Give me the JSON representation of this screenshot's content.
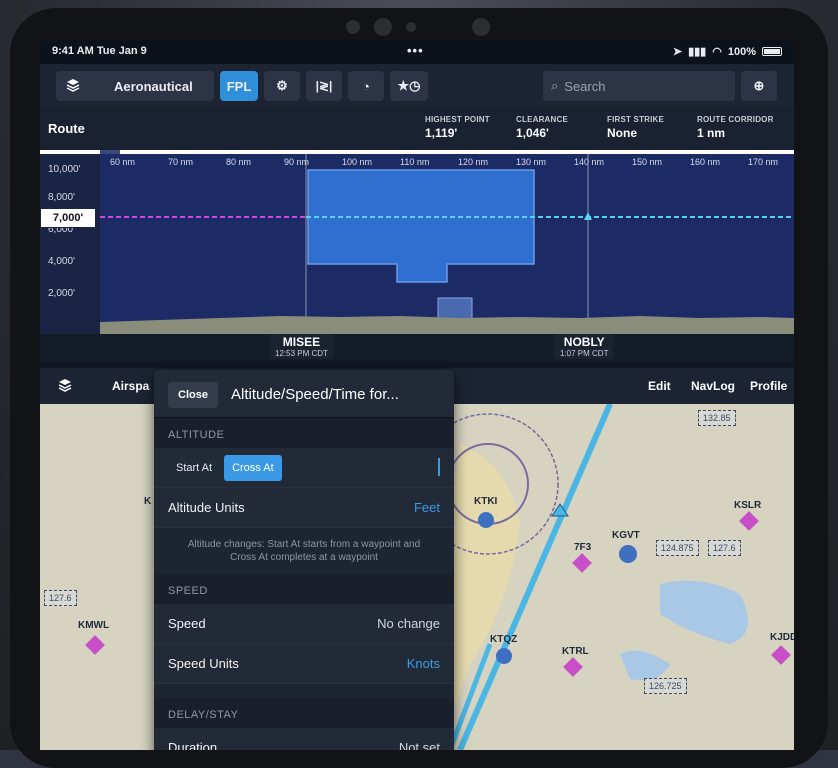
{
  "status_bar": {
    "time": "9:41 AM  Tue Jan 9",
    "dots": "•••",
    "battery": "100%"
  },
  "toolbar": {
    "layer_label": "Aeronautical",
    "fpl_label": "FPL",
    "search_placeholder": "Search"
  },
  "profile": {
    "route_label": "Route",
    "stats": [
      {
        "key": "HIGHEST POINT",
        "value": "1,119'"
      },
      {
        "key": "CLEARANCE",
        "value": "1,046'"
      },
      {
        "key": "FIRST STRIKE",
        "value": "None"
      },
      {
        "key": "ROUTE CORRIDOR",
        "value": "1 nm"
      }
    ],
    "altitude_ticks": [
      "10,000'",
      "8,000'",
      "6,000'",
      "4,000'",
      "2,000'"
    ],
    "selected_altitude": "7,000'",
    "distance_ticks": [
      "60 nm",
      "70 nm",
      "80 nm",
      "90 nm",
      "100 nm",
      "110 nm",
      "120 nm",
      "130 nm",
      "140 nm",
      "150 nm",
      "160 nm",
      "170 nm"
    ],
    "waypoints": [
      {
        "name": "MISEE",
        "time": "12:53 PM CDT"
      },
      {
        "name": "NOBLY",
        "time": "1:07 PM CDT"
      }
    ]
  },
  "map_bar": {
    "airspace_label": "Airspa",
    "edit_label": "Edit",
    "navlog_label": "NavLog",
    "profile_label": "Profile"
  },
  "map": {
    "airports": [
      "KTKI",
      "KSLR",
      "KGVT",
      "7F3",
      "KTRL",
      "KJDD",
      "KMWL",
      "K"
    ],
    "airport_partial": "KTQZ",
    "freqs": [
      "132.85",
      "124.875",
      "127.6",
      "126.725",
      "127.6"
    ]
  },
  "popup": {
    "close_label": "Close",
    "title": "Altitude/Speed/Time for...",
    "altitude_section": "ALTITUDE",
    "start_at": "Start At",
    "cross_at": "Cross At",
    "altitude_units_label": "Altitude Units",
    "altitude_units_value": "Feet",
    "note": "Altitude changes: Start At starts from a waypoint and Cross At completes at a waypoint",
    "speed_section": "SPEED",
    "speed_label": "Speed",
    "speed_value": "No change",
    "speed_units_label": "Speed Units",
    "speed_units_value": "Knots",
    "delay_section": "DELAY/STAY",
    "duration_label": "Duration",
    "duration_value": "Not set"
  },
  "colors": {
    "accent": "#2f8fd9",
    "route_pink": "#e040e0",
    "route_cyan": "#5ad1f0",
    "airspace_blue": "#2f6fd0"
  }
}
